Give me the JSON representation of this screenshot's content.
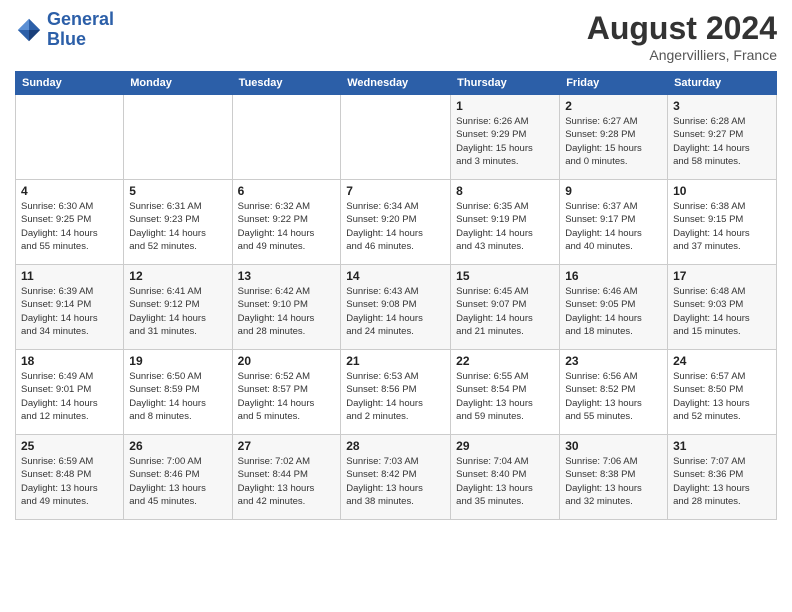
{
  "header": {
    "logo_line1": "General",
    "logo_line2": "Blue",
    "month_year": "August 2024",
    "location": "Angervilliers, France"
  },
  "days_of_week": [
    "Sunday",
    "Monday",
    "Tuesday",
    "Wednesday",
    "Thursday",
    "Friday",
    "Saturday"
  ],
  "weeks": [
    [
      {
        "day": "",
        "info": ""
      },
      {
        "day": "",
        "info": ""
      },
      {
        "day": "",
        "info": ""
      },
      {
        "day": "",
        "info": ""
      },
      {
        "day": "1",
        "info": "Sunrise: 6:26 AM\nSunset: 9:29 PM\nDaylight: 15 hours\nand 3 minutes."
      },
      {
        "day": "2",
        "info": "Sunrise: 6:27 AM\nSunset: 9:28 PM\nDaylight: 15 hours\nand 0 minutes."
      },
      {
        "day": "3",
        "info": "Sunrise: 6:28 AM\nSunset: 9:27 PM\nDaylight: 14 hours\nand 58 minutes."
      }
    ],
    [
      {
        "day": "4",
        "info": "Sunrise: 6:30 AM\nSunset: 9:25 PM\nDaylight: 14 hours\nand 55 minutes."
      },
      {
        "day": "5",
        "info": "Sunrise: 6:31 AM\nSunset: 9:23 PM\nDaylight: 14 hours\nand 52 minutes."
      },
      {
        "day": "6",
        "info": "Sunrise: 6:32 AM\nSunset: 9:22 PM\nDaylight: 14 hours\nand 49 minutes."
      },
      {
        "day": "7",
        "info": "Sunrise: 6:34 AM\nSunset: 9:20 PM\nDaylight: 14 hours\nand 46 minutes."
      },
      {
        "day": "8",
        "info": "Sunrise: 6:35 AM\nSunset: 9:19 PM\nDaylight: 14 hours\nand 43 minutes."
      },
      {
        "day": "9",
        "info": "Sunrise: 6:37 AM\nSunset: 9:17 PM\nDaylight: 14 hours\nand 40 minutes."
      },
      {
        "day": "10",
        "info": "Sunrise: 6:38 AM\nSunset: 9:15 PM\nDaylight: 14 hours\nand 37 minutes."
      }
    ],
    [
      {
        "day": "11",
        "info": "Sunrise: 6:39 AM\nSunset: 9:14 PM\nDaylight: 14 hours\nand 34 minutes."
      },
      {
        "day": "12",
        "info": "Sunrise: 6:41 AM\nSunset: 9:12 PM\nDaylight: 14 hours\nand 31 minutes."
      },
      {
        "day": "13",
        "info": "Sunrise: 6:42 AM\nSunset: 9:10 PM\nDaylight: 14 hours\nand 28 minutes."
      },
      {
        "day": "14",
        "info": "Sunrise: 6:43 AM\nSunset: 9:08 PM\nDaylight: 14 hours\nand 24 minutes."
      },
      {
        "day": "15",
        "info": "Sunrise: 6:45 AM\nSunset: 9:07 PM\nDaylight: 14 hours\nand 21 minutes."
      },
      {
        "day": "16",
        "info": "Sunrise: 6:46 AM\nSunset: 9:05 PM\nDaylight: 14 hours\nand 18 minutes."
      },
      {
        "day": "17",
        "info": "Sunrise: 6:48 AM\nSunset: 9:03 PM\nDaylight: 14 hours\nand 15 minutes."
      }
    ],
    [
      {
        "day": "18",
        "info": "Sunrise: 6:49 AM\nSunset: 9:01 PM\nDaylight: 14 hours\nand 12 minutes."
      },
      {
        "day": "19",
        "info": "Sunrise: 6:50 AM\nSunset: 8:59 PM\nDaylight: 14 hours\nand 8 minutes."
      },
      {
        "day": "20",
        "info": "Sunrise: 6:52 AM\nSunset: 8:57 PM\nDaylight: 14 hours\nand 5 minutes."
      },
      {
        "day": "21",
        "info": "Sunrise: 6:53 AM\nSunset: 8:56 PM\nDaylight: 14 hours\nand 2 minutes."
      },
      {
        "day": "22",
        "info": "Sunrise: 6:55 AM\nSunset: 8:54 PM\nDaylight: 13 hours\nand 59 minutes."
      },
      {
        "day": "23",
        "info": "Sunrise: 6:56 AM\nSunset: 8:52 PM\nDaylight: 13 hours\nand 55 minutes."
      },
      {
        "day": "24",
        "info": "Sunrise: 6:57 AM\nSunset: 8:50 PM\nDaylight: 13 hours\nand 52 minutes."
      }
    ],
    [
      {
        "day": "25",
        "info": "Sunrise: 6:59 AM\nSunset: 8:48 PM\nDaylight: 13 hours\nand 49 minutes."
      },
      {
        "day": "26",
        "info": "Sunrise: 7:00 AM\nSunset: 8:46 PM\nDaylight: 13 hours\nand 45 minutes."
      },
      {
        "day": "27",
        "info": "Sunrise: 7:02 AM\nSunset: 8:44 PM\nDaylight: 13 hours\nand 42 minutes."
      },
      {
        "day": "28",
        "info": "Sunrise: 7:03 AM\nSunset: 8:42 PM\nDaylight: 13 hours\nand 38 minutes."
      },
      {
        "day": "29",
        "info": "Sunrise: 7:04 AM\nSunset: 8:40 PM\nDaylight: 13 hours\nand 35 minutes."
      },
      {
        "day": "30",
        "info": "Sunrise: 7:06 AM\nSunset: 8:38 PM\nDaylight: 13 hours\nand 32 minutes."
      },
      {
        "day": "31",
        "info": "Sunrise: 7:07 AM\nSunset: 8:36 PM\nDaylight: 13 hours\nand 28 minutes."
      }
    ]
  ]
}
